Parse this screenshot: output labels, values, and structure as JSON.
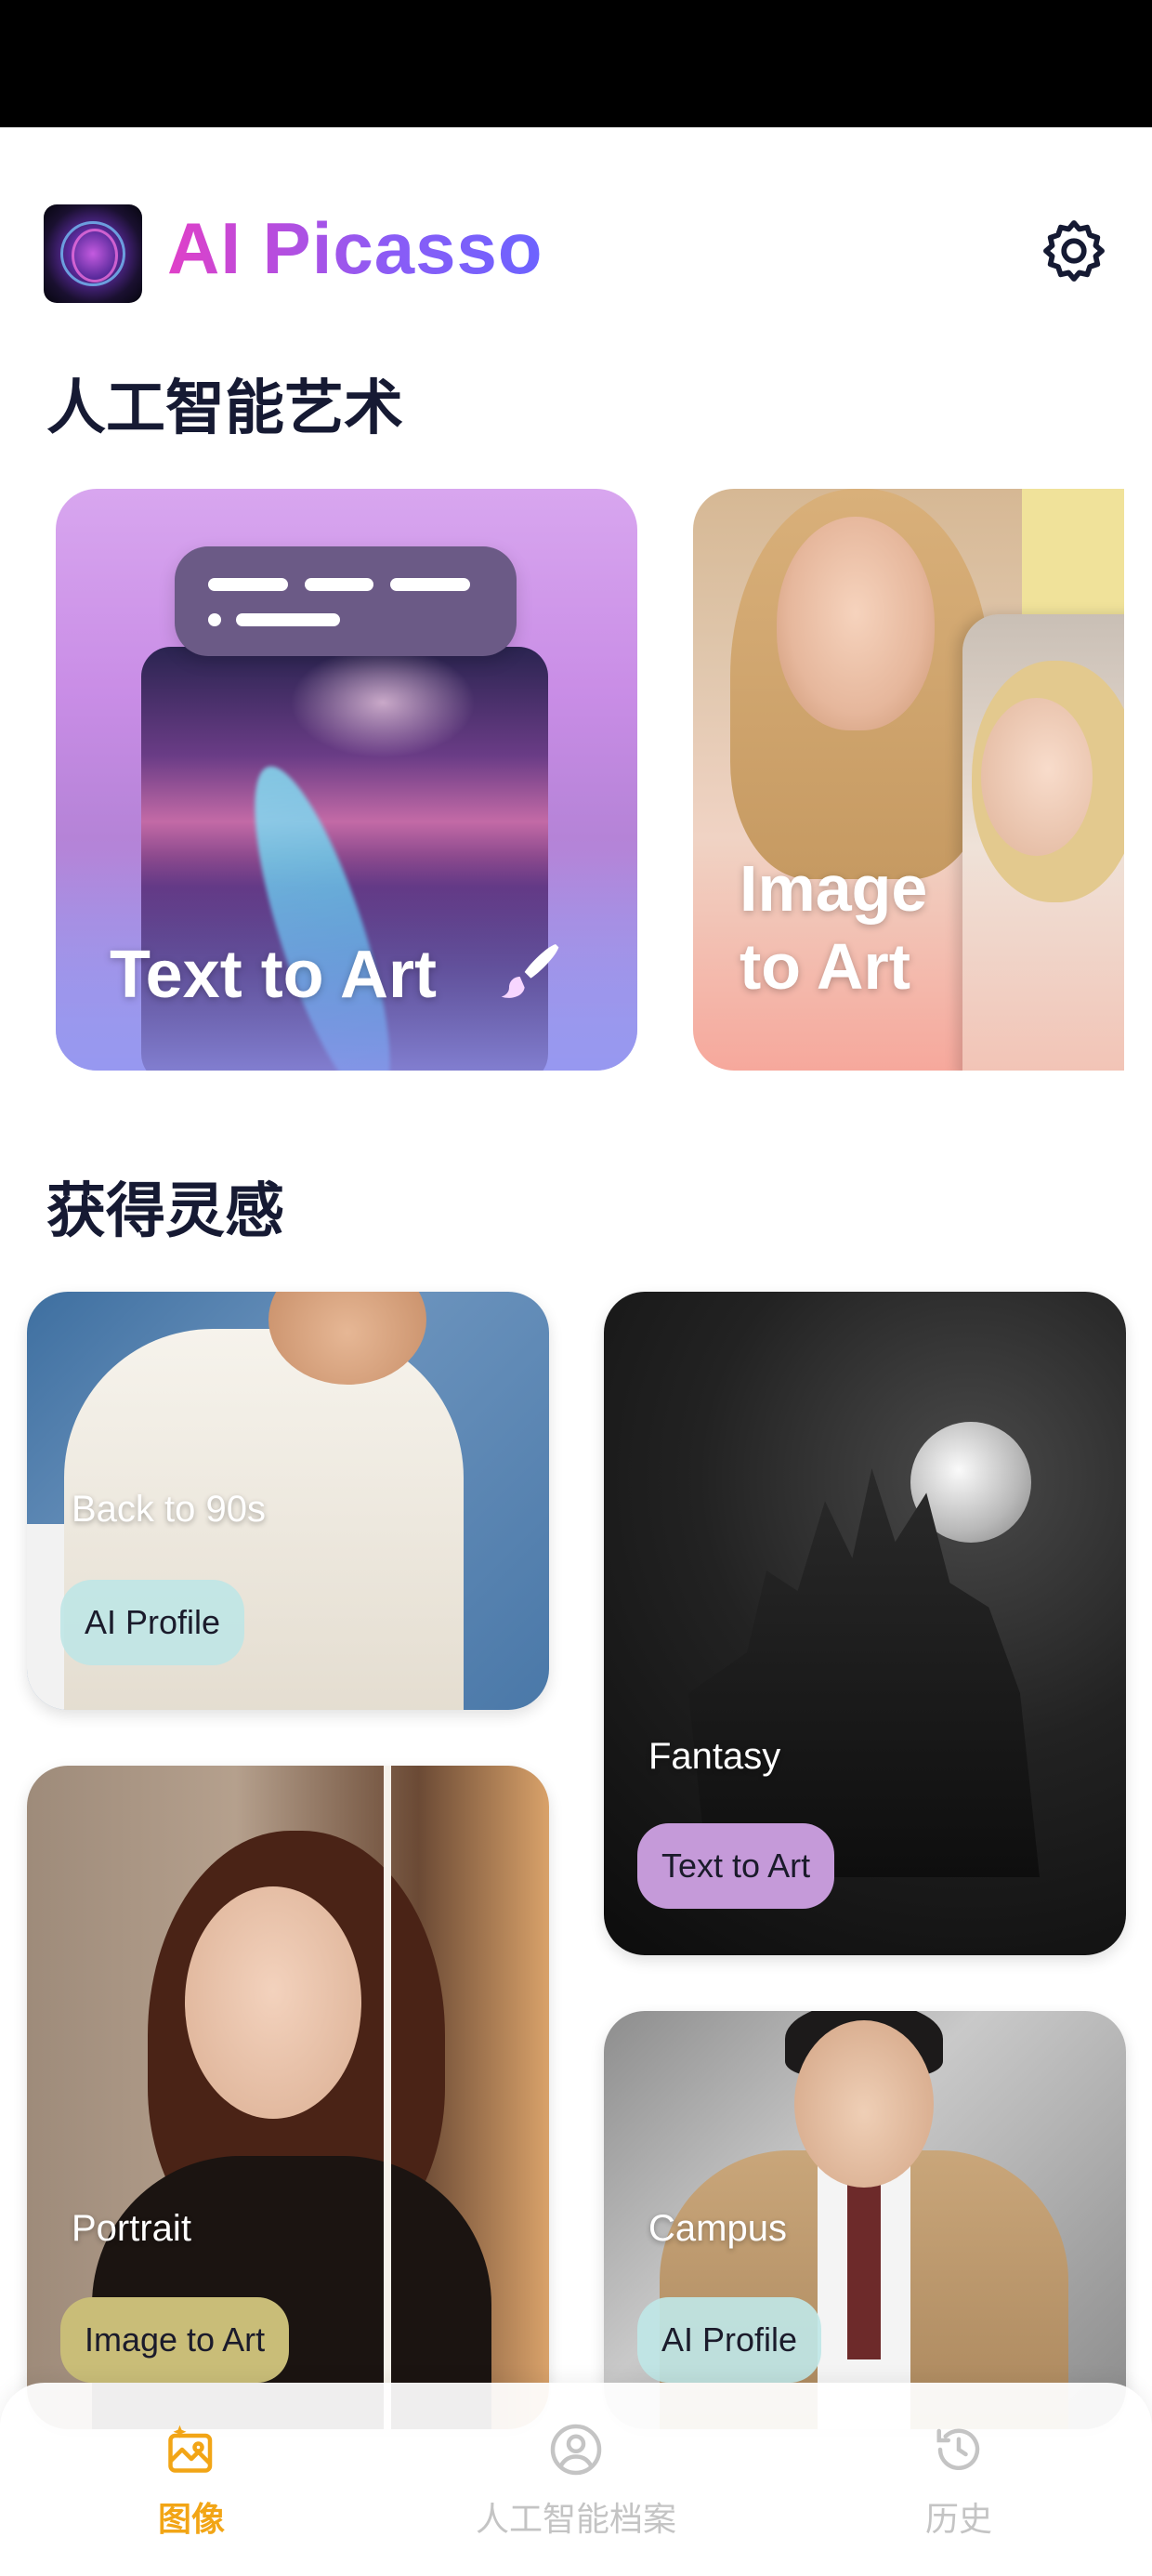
{
  "app": {
    "title": "AI Picasso"
  },
  "sections": {
    "ai_art": "人工智能艺术",
    "inspiration": "获得灵感"
  },
  "features": [
    {
      "label": "Text to Art"
    },
    {
      "label_line1": "Image",
      "label_line2": "to Art"
    }
  ],
  "inspiration": [
    {
      "title": "Back to 90s",
      "tag": "AI Profile"
    },
    {
      "title": "Fantasy",
      "tag": "Text to Art"
    },
    {
      "title": "Portrait",
      "tag": "Image to Art"
    },
    {
      "title": "Campus",
      "tag": "AI Profile"
    }
  ],
  "nav": [
    {
      "label": "图像",
      "active": true
    },
    {
      "label": "人工智能档案",
      "active": false
    },
    {
      "label": "历史",
      "active": false
    }
  ],
  "colors": {
    "accent": "#f2a516",
    "inactive": "#c4c4c4",
    "title_gradient_start": "#e040c8",
    "title_gradient_end": "#6c63ff",
    "pill_teal": "#bfe6e6",
    "pill_purple": "#c59ad9",
    "pill_olive": "#c9bd78"
  }
}
